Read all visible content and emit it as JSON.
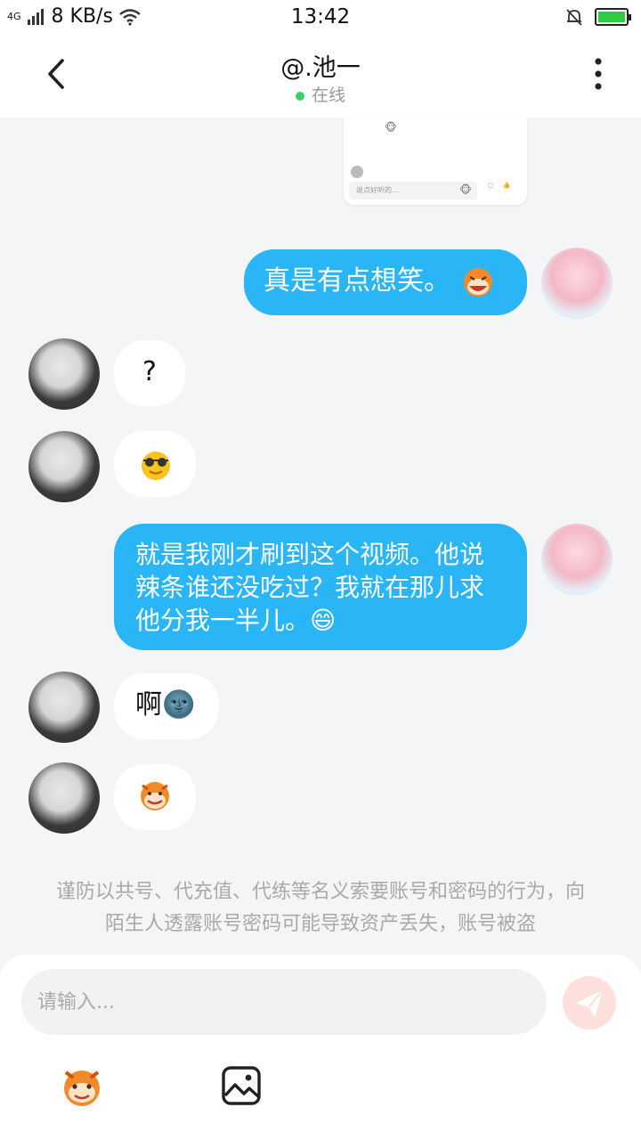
{
  "status_bar": {
    "network_type": "4G",
    "speed": "8 KB/s",
    "time": "13:42"
  },
  "header": {
    "title": "@.池一",
    "presence": "在线"
  },
  "shared_card": {
    "caption": "说点好听的..."
  },
  "messages": [
    {
      "side": "me",
      "text": "真是有点想笑。"
    },
    {
      "side": "other",
      "text": "?"
    },
    {
      "side": "other",
      "text": ""
    },
    {
      "side": "me",
      "text": "就是我刚才刷到这个视频。他说辣条谁还没吃过？我就在那儿求他分我一半儿。😄"
    },
    {
      "side": "other",
      "text": "啊🌚"
    },
    {
      "side": "other",
      "text": ""
    }
  ],
  "notice": "谨防以共号、代充值、代练等名义索要账号和密码的行为，向陌生人透露账号密码可能导致资产丢失，账号被盗",
  "composer": {
    "placeholder": "请输入..."
  },
  "icons": {
    "back": "chevron-left-icon",
    "more": "more-vertical-icon",
    "send": "send-icon",
    "emoji": "emoji-mascot-icon",
    "image": "image-icon"
  },
  "colors": {
    "my_bubble": "#29b5f6",
    "online_dot": "#3bd06a",
    "send_button": "#fde0dc",
    "background": "#f4f5f7"
  }
}
